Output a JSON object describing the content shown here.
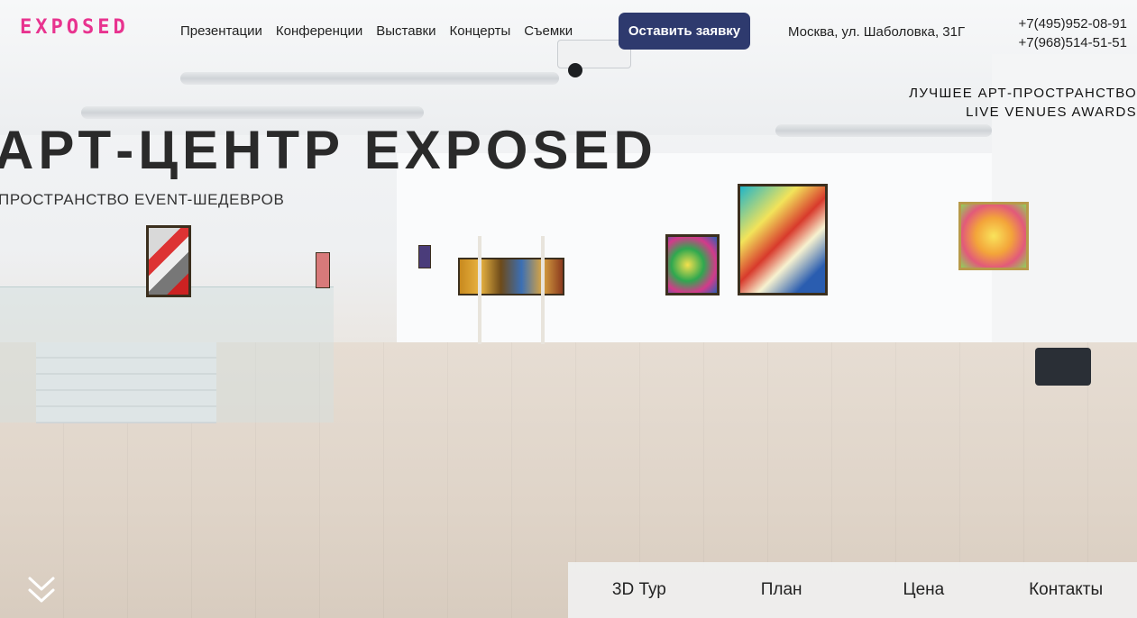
{
  "brand": {
    "logo_text": "EXPOSED",
    "accent_color": "#e8338f",
    "cta_color": "#2e3a6e"
  },
  "nav": {
    "items": [
      {
        "label": "Презентации"
      },
      {
        "label": "Конференции"
      },
      {
        "label": "Выставки"
      },
      {
        "label": "Концерты"
      },
      {
        "label": "Съемки"
      }
    ],
    "cta_label": "Оставить заявку"
  },
  "contact": {
    "address": "Москва, ул. Шаболовка, 31Г",
    "phones": [
      "+7(495)952-08-91",
      "+7(968)514-51-51"
    ]
  },
  "award": {
    "line1": "ЛУЧШЕЕ АРТ-ПРОСТРАНСТВО",
    "line2": "LIVE VENUES AWARDS"
  },
  "hero": {
    "title": "АРТ-ЦЕНТР EXPOSED",
    "subtitle": "ПРОСТРАНСТВО EVENT-ШЕДЕВРОВ"
  },
  "bottom_nav": {
    "items": [
      {
        "label": "3D Тур"
      },
      {
        "label": "План"
      },
      {
        "label": "Цена"
      },
      {
        "label": "Контакты"
      }
    ]
  },
  "icons": {
    "scroll": "double-chevron-down-icon"
  }
}
